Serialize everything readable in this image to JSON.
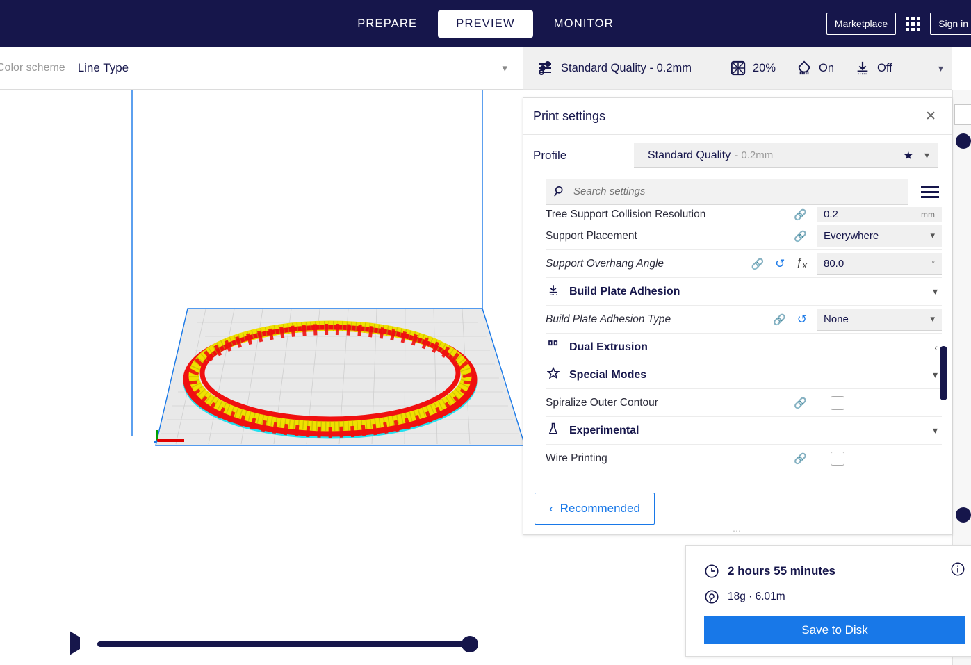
{
  "topbar": {
    "tabs": [
      {
        "label": "PREPARE",
        "active": false
      },
      {
        "label": "PREVIEW",
        "active": true
      },
      {
        "label": "MONITOR",
        "active": false
      }
    ],
    "marketplace_label": "Marketplace",
    "signin_label": "Sign in",
    "apps_icon": "grid-apps-icon",
    "background_color": "#16164b"
  },
  "viewbar": {
    "color_scheme_label": "Color scheme",
    "color_scheme_value": "Line Type",
    "caret_icon": "chevron-down-icon"
  },
  "machinebar": {
    "profile_icon": "sliders-icon",
    "profile_label": "Standard Quality - 0.2mm",
    "infill_icon": "infill-icon",
    "infill_value": "20%",
    "support_icon": "support-icon",
    "support_value": "On",
    "adhesion_icon": "adhesion-icon",
    "adhesion_value": "Off",
    "caret_icon": "chevron-down-icon"
  },
  "print_settings": {
    "title": "Print settings",
    "close_icon": "close-icon",
    "profile_label": "Profile",
    "profile_name": "Standard Quality",
    "profile_sub": "- 0.2mm",
    "star_icon": "star-icon",
    "profile_caret_icon": "chevron-down-icon",
    "search": {
      "icon": "search-icon",
      "placeholder": "Search settings",
      "value": ""
    },
    "menu_icon": "hamburger-icon",
    "rows": [
      {
        "type": "setting",
        "label": "Tree Support Collision Resolution",
        "italic": false,
        "clipped": true,
        "has_link": true,
        "has_reset": false,
        "has_fx": false,
        "value": "0.2",
        "unit": "mm",
        "control": "text"
      },
      {
        "type": "setting",
        "label": "Support Placement",
        "italic": false,
        "clipped": false,
        "has_link": true,
        "has_reset": false,
        "has_fx": false,
        "value": "Everywhere",
        "unit": "",
        "control": "dropdown"
      },
      {
        "type": "setting",
        "label": "Support Overhang Angle",
        "italic": true,
        "clipped": false,
        "has_link": true,
        "has_reset": true,
        "has_fx": true,
        "value": "80.0",
        "unit": "°",
        "control": "text"
      },
      {
        "type": "category",
        "label": "Build Plate Adhesion",
        "icon": "adhesion-icon",
        "caret": "chevron-down-icon"
      },
      {
        "type": "setting",
        "label": "Build Plate Adhesion Type",
        "italic": true,
        "clipped": false,
        "has_link": true,
        "has_reset": true,
        "has_fx": false,
        "value": "None",
        "unit": "",
        "control": "dropdown"
      },
      {
        "type": "category",
        "label": "Dual Extrusion",
        "icon": "dual-extrusion-icon",
        "caret": "chevron-left-icon"
      },
      {
        "type": "category",
        "label": "Special Modes",
        "icon": "star-outline-icon",
        "caret": "chevron-down-icon"
      },
      {
        "type": "setting",
        "label": "Spiralize Outer Contour",
        "italic": false,
        "clipped": false,
        "has_link": true,
        "has_reset": false,
        "has_fx": false,
        "value": "",
        "unit": "",
        "control": "checkbox",
        "checked": false
      },
      {
        "type": "category",
        "label": "Experimental",
        "icon": "flask-icon",
        "caret": "chevron-down-icon"
      },
      {
        "type": "setting",
        "label": "Wire Printing",
        "italic": false,
        "clipped": false,
        "has_link": true,
        "has_reset": false,
        "has_fx": false,
        "value": "",
        "unit": "",
        "control": "checkbox",
        "checked": false
      }
    ],
    "recommended_label": "Recommended",
    "recommended_caret": "chevron-left-icon"
  },
  "print_info": {
    "time_icon": "clock-icon",
    "time": "2 hours 55 minutes",
    "info_icon": "info-icon",
    "material_icon": "spool-icon",
    "material": "18g · 6.01m",
    "save_label": "Save to Disk",
    "accent_color": "#1878e8"
  },
  "layer_slider": {
    "play_icon": "play-icon",
    "value": 100,
    "min": 0,
    "max": 100
  },
  "viewport": {
    "model_name": "sliced-ring-preview",
    "colors": {
      "wall": "#f0e000",
      "skin": "#ff0000",
      "support": "#00e0e0",
      "build_plate_outline": "#1878e8",
      "grid": "#d8d8d8"
    }
  }
}
